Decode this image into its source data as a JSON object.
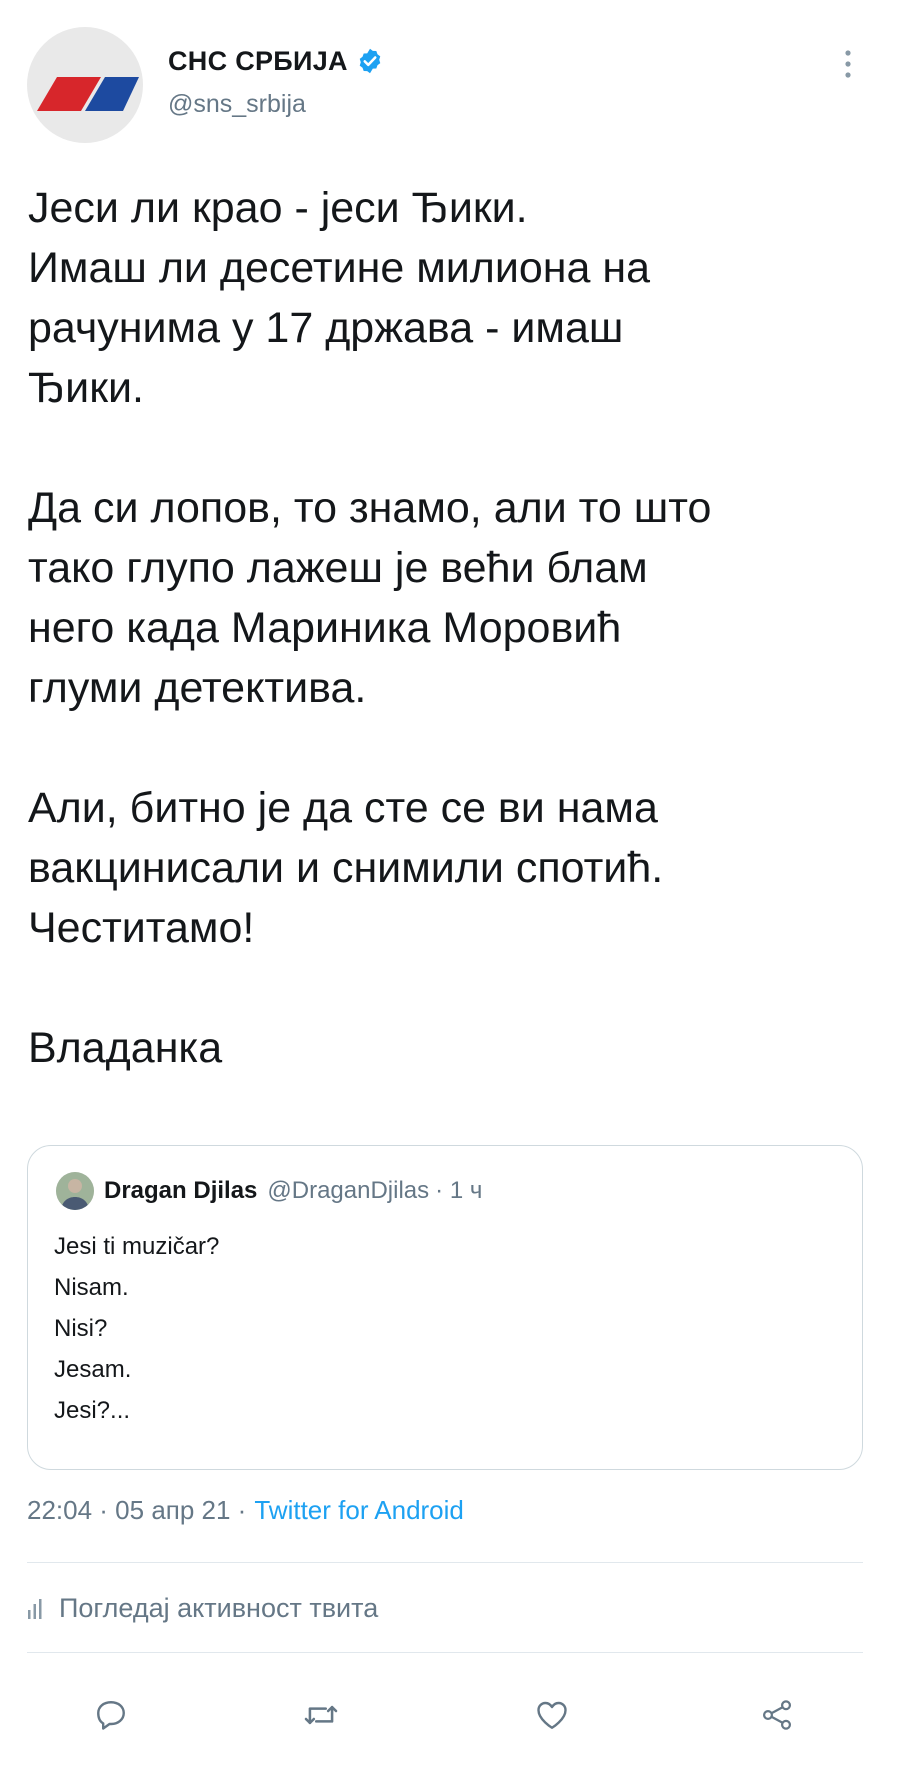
{
  "header": {
    "display_name": "СНС СРБИЈА",
    "handle": "@sns_srbija",
    "verified": true,
    "icons": {
      "verified": "verified-badge-icon",
      "more": "more-vertical-icon"
    },
    "brand_colors": {
      "red": "#d7262b",
      "blue": "#1d4aa0",
      "verified_blue": "#1da1f2"
    }
  },
  "tweet": {
    "lines_block_1": [
      "Јеси ли крао - јеси Ђики.",
      "Имаш ли десетине милиона на",
      "рачунима у 17 држава - имаш",
      "Ђики."
    ],
    "lines_block_2": [
      "Да си лопов, то знамо, али то што",
      "тако глупо лажеш је већи блам",
      "него када Мариника Моровић",
      "глуми детектива."
    ],
    "lines_block_3": [
      "Али, битно је да сте се ви нама",
      "вакцинисали и снимили спотић.",
      "Честитамо!"
    ],
    "lines_block_4": [
      "Владанка"
    ]
  },
  "quote": {
    "name": "Dragan Djilas",
    "handle": "@DraganDjilas",
    "time": "· 1 ч",
    "lines": [
      "Jesi ti muzičar?",
      "Nisam.",
      "Nisi?",
      "Jesam.",
      "Jesi?..."
    ]
  },
  "meta": {
    "timestamp": "22:04 · 05 апр 21 ·",
    "client": "Twitter for Android"
  },
  "activity": {
    "label": "Погледај активност твита",
    "icon": "analytics-icon"
  },
  "actions": {
    "icons": [
      "reply-icon",
      "retweet-icon",
      "like-icon",
      "share-icon"
    ]
  }
}
